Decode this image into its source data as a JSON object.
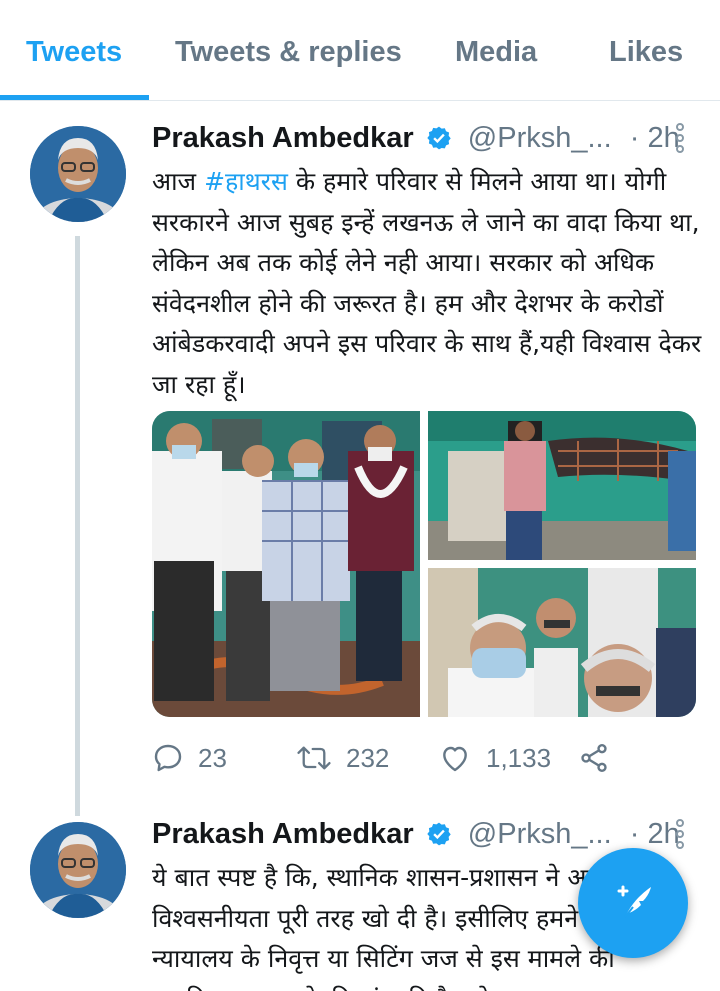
{
  "tabs": [
    {
      "label": "Tweets",
      "active": true
    },
    {
      "label": "Tweets & replies",
      "active": false
    },
    {
      "label": "Media",
      "active": false
    },
    {
      "label": "Likes",
      "active": false
    }
  ],
  "colors": {
    "accent": "#1da1f2",
    "secondary_text": "#657786",
    "primary_text": "#14171a"
  },
  "tweets": [
    {
      "author": "Prakash Ambedkar",
      "verified": true,
      "handle": "@Prksh_...",
      "time": "· 2h",
      "text_before": "आज ",
      "hashtag": "#हाथरस",
      "text_after": " के हमारे परिवार से मिलने आया था। योगी सरकारने आज सुबह इन्हें लखनऊ ले जाने का वादा किया था, लेकिन अब तक कोई लेने नही आया। सरकार को अधिक संवेदनशील होने की जरूरत है। हम और देशभर के करोडों आंबेडकरवादी अपने इस परिवार के साथ हैं,यही विश्वास देकर जा रहा हूँ।",
      "photos": [
        "photo-group-visit",
        "photo-camera-crew",
        "photo-masked-men"
      ],
      "replies": "23",
      "retweets": "232",
      "likes": "1,133"
    },
    {
      "author": "Prakash Ambedkar",
      "verified": true,
      "handle": "@Prksh_...",
      "time": "· 2h",
      "text": "ये बात स्पष्ट है कि, स्थानिक शासन-प्रशासन ने अपनी विश्वसनीयता पूरी तरह खो दी है। इसीलिए हमने सर्वोच्च न्यायालय के निवृत्त या सिटिंग जज से इस मामले की तहकीकात करवाने की मांग की है, जो"
    }
  ],
  "icons": {
    "verified": "verified-badge-icon",
    "more": "more-vertical-icon",
    "reply": "reply-icon",
    "retweet": "retweet-icon",
    "like": "heart-icon",
    "share": "share-icon",
    "compose": "compose-tweet-icon"
  }
}
